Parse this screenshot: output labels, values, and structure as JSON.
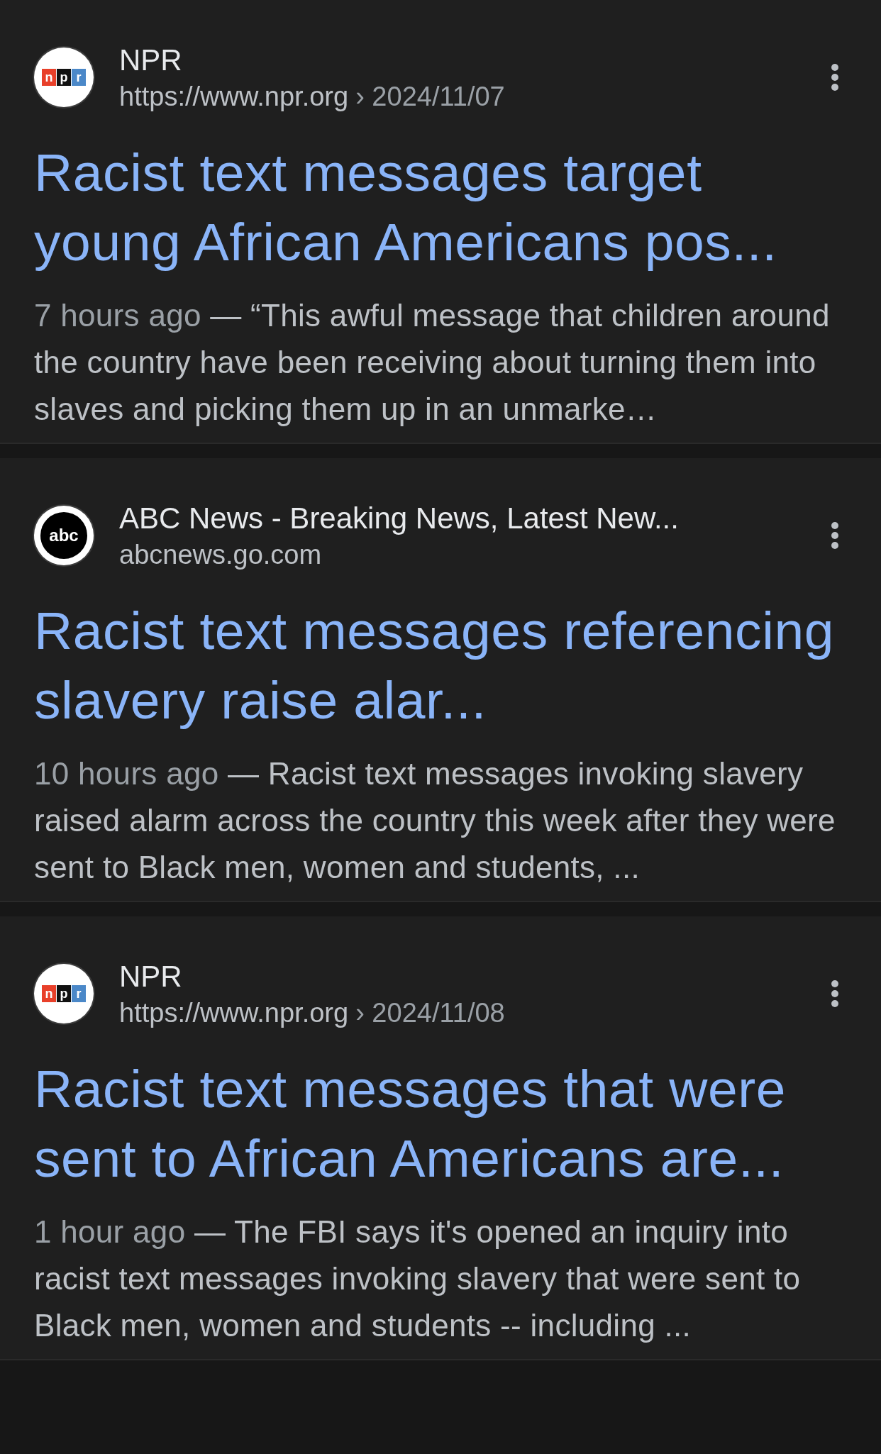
{
  "results": [
    {
      "logo": {
        "kind": "npr",
        "letters": [
          "n",
          "p",
          "r"
        ]
      },
      "source": "NPR",
      "url": "https://www.npr.org",
      "breadcrumb": "› 2024/11/07",
      "title": "Racist text messages target young African Americans pos...",
      "date": "7 hours ago",
      "snippet": "— “This awful message that children around the country have been receiving about turning them into slaves and picking them up in an unmarke…"
    },
    {
      "logo": {
        "kind": "abc",
        "text": "abc"
      },
      "source": "ABC News - Breaking News, Latest New...",
      "url": "abcnews.go.com",
      "title": "Racist text messages referencing slavery raise alar...",
      "date": "10 hours ago",
      "snippet": "— Racist text messages invoking slavery raised alarm across the country this week after they were sent to Black men, women and students, ..."
    },
    {
      "logo": {
        "kind": "npr",
        "letters": [
          "n",
          "p",
          "r"
        ]
      },
      "source": "NPR",
      "url": "https://www.npr.org",
      "breadcrumb": "› 2024/11/08",
      "title": "Racist text messages that were sent to African Americans are...",
      "date": "1 hour ago",
      "snippet": "— The FBI says it's opened an inquiry into racist text messages invoking slavery that were sent to Black men, women and students -- including ..."
    }
  ]
}
